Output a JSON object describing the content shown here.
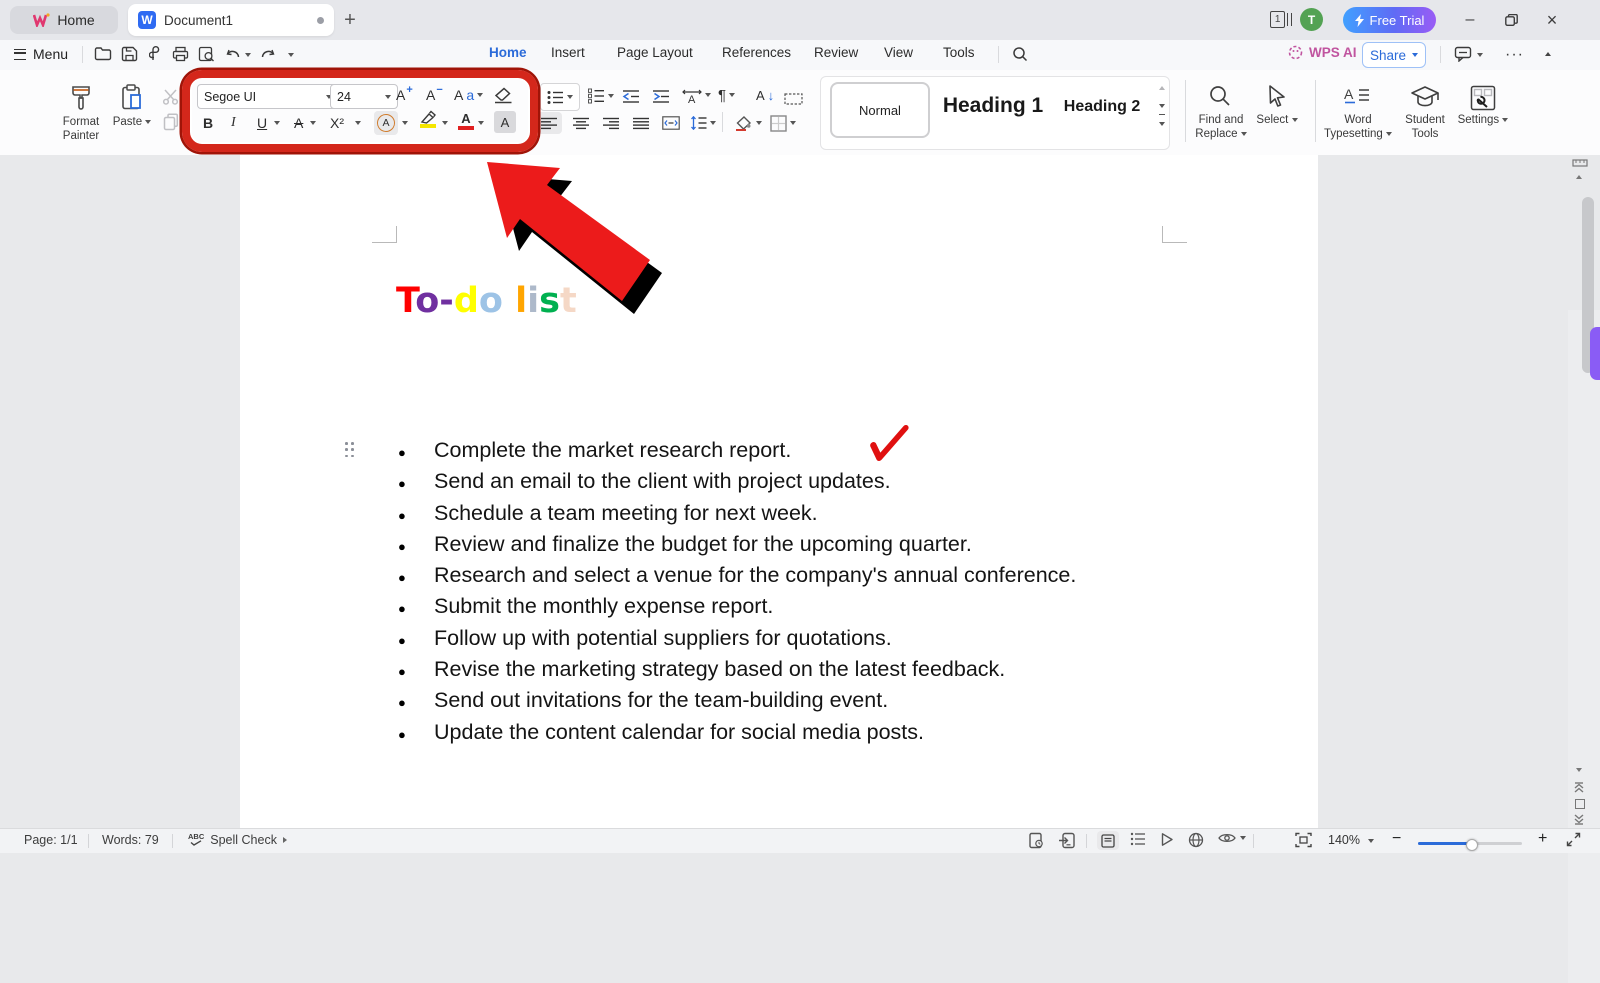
{
  "titlebar": {
    "home_tab": "Home",
    "document_tab": "Document1",
    "window_count": "1",
    "avatar_initial": "T",
    "free_trial_label": "Free Trial"
  },
  "menubar": {
    "menu_label": "Menu",
    "tabs": [
      "Home",
      "Insert",
      "Page Layout",
      "References",
      "Review",
      "View",
      "Tools"
    ],
    "active_tab": "Home",
    "wps_ai_label": "WPS AI",
    "share_label": "Share"
  },
  "ribbon": {
    "format_painter_line1": "Format",
    "format_painter_line2": "Painter",
    "paste_label": "Paste",
    "font_name": "Segoe UI",
    "font_size": "24",
    "glyphs": {
      "a": "A",
      "plus": "+",
      "minus": "−",
      "case_upper": "A",
      "case_lower": "a",
      "bold": "B",
      "italic": "I",
      "underline": "U",
      "strike": "A",
      "superscript": "X²",
      "enclose": "A",
      "highlight": "",
      "font_color": "A",
      "char_shade": "A",
      "pilcrow": "¶",
      "sort_letter": "A",
      "sort_arrow": "↓"
    },
    "styles": {
      "normal": "Normal",
      "heading1": "Heading 1",
      "heading2": "Heading 2"
    },
    "find_line1": "Find and",
    "find_line2": "Replace",
    "select_label": "Select",
    "wt_line1": "Word",
    "wt_line2": "Typesetting",
    "st_line1": "Student",
    "st_line2": "Tools",
    "settings_label": "Settings"
  },
  "document": {
    "bullet_char": "●",
    "title_letters": [
      {
        "ch": "T",
        "css": "color:#FF0000"
      },
      {
        "ch": "o",
        "css": "color:#7030A0"
      },
      {
        "ch": "-",
        "css": "color:#7030A0"
      },
      {
        "ch": "d",
        "css": "color:#FFFF00"
      },
      {
        "ch": "o",
        "css": "color:#9DC3E6"
      },
      {
        "ch": " ",
        "css": ""
      },
      {
        "ch": "l",
        "css": "color:#FFA500"
      },
      {
        "ch": "i",
        "css": "color:#ADB9CA"
      },
      {
        "ch": "s",
        "css": "color:#00B050"
      },
      {
        "ch": "t",
        "css": "color:#F5D8C6"
      }
    ],
    "items": [
      "Complete the market research report.",
      "Send an email to the client with project updates.",
      "Schedule a team meeting for next week.",
      "Review and finalize the budget for the upcoming quarter.",
      "Research and select a venue for the company's annual conference.",
      "Submit the monthly expense report.",
      "Follow up with potential suppliers for quotations.",
      "Revise the marketing strategy based on the latest feedback.",
      "Send out invitations for the team-building event.",
      "Update the content calendar for social media posts."
    ]
  },
  "statusbar": {
    "page": "Page: 1/1",
    "words": "Words: 79",
    "spell_abc": "ABC",
    "spell_check": "Spell Check",
    "zoom_level": "140%"
  },
  "colors": {
    "accent_blue": "#2B6BD9",
    "annotation_red": "#D4271B",
    "arrow_red": "#EC1B1B",
    "checkmark_red": "#E01010",
    "free_trial_gradient": [
      "#41A0FF",
      "#9A5CF5"
    ],
    "avatar_green": "#53A253",
    "ai_pill_purple": "#8A5CF5"
  }
}
